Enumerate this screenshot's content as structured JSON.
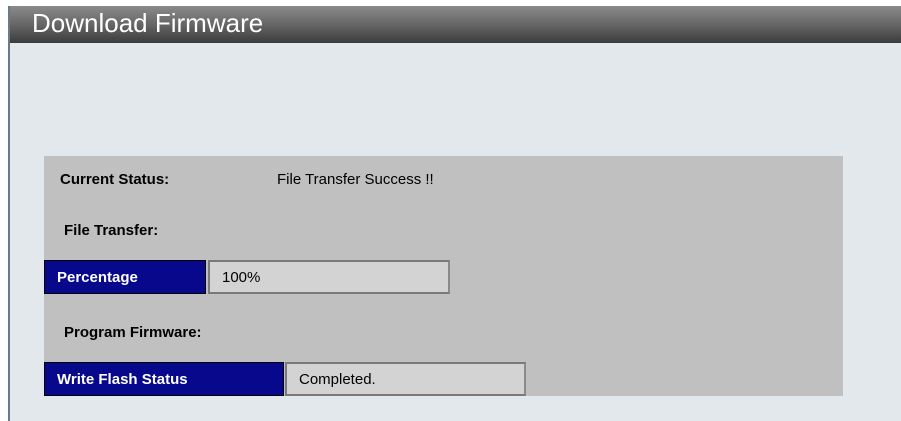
{
  "window": {
    "title": "Download Firmware"
  },
  "status": {
    "current_status_label": "Current Status:",
    "current_status_value": "File Transfer Success !!",
    "file_transfer_label": "File Transfer:",
    "percentage_label": "Percentage",
    "percentage_value": "100%",
    "percentage_fraction": 1.0,
    "program_firmware_label": "Program Firmware:",
    "write_flash_label": "Write Flash Status",
    "write_flash_value": "Completed."
  },
  "colors": {
    "header_cell_bg": "#08088c",
    "panel_bg": "#c0c0c0",
    "page_bg": "#e3e8ec"
  }
}
